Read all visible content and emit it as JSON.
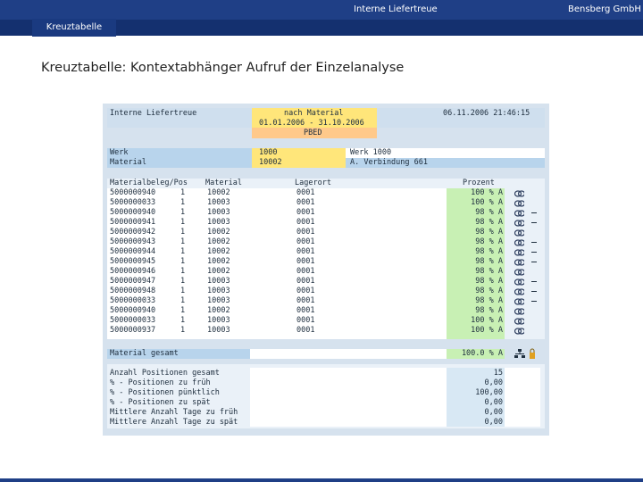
{
  "header": {
    "center_title": "Interne Liefertreue",
    "company": "Bensberg GmbH",
    "tab_label": "Kreuztabelle"
  },
  "page_title": "Kreuztabelle: Kontextabhänger Aufruf der Einzelanalyse",
  "sap": {
    "title": "Interne Liefertreue",
    "filter_label": "nach Material",
    "date_range": "01.01.2006 - 31.10.2006",
    "timestamp": "06.11.2006 21:46:15",
    "code": "PBED",
    "werk_label": "Werk",
    "werk_value": "1000",
    "werk_name": "Werk 1000",
    "material_label": "Material",
    "material_value": "10002",
    "material_name": "A. Verbindung 661",
    "columns": [
      "Materialbeleg/Pos",
      "Material",
      "Lagerort",
      "Prozent"
    ],
    "rows": [
      {
        "beleg": "5000000940",
        "pos": "1",
        "material": "10002",
        "lager": "0001",
        "prozent": "100 % A",
        "chain": true,
        "minus": false
      },
      {
        "beleg": "5000000033",
        "pos": "1",
        "material": "10003",
        "lager": "0001",
        "prozent": "100 % A",
        "chain": true,
        "minus": false
      },
      {
        "beleg": "5000000940",
        "pos": "1",
        "material": "10003",
        "lager": "0001",
        "prozent": "98 % A",
        "chain": true,
        "minus": true
      },
      {
        "beleg": "5000000941",
        "pos": "1",
        "material": "10003",
        "lager": "0001",
        "prozent": "98 % A",
        "chain": true,
        "minus": true
      },
      {
        "beleg": "5000000942",
        "pos": "1",
        "material": "10002",
        "lager": "0001",
        "prozent": "98 % A",
        "chain": true,
        "minus": false
      },
      {
        "beleg": "5000000943",
        "pos": "1",
        "material": "10002",
        "lager": "0001",
        "prozent": "98 % A",
        "chain": true,
        "minus": true
      },
      {
        "beleg": "5000000944",
        "pos": "1",
        "material": "10002",
        "lager": "0001",
        "prozent": "98 % A",
        "chain": true,
        "minus": true
      },
      {
        "beleg": "5000000945",
        "pos": "1",
        "material": "10002",
        "lager": "0001",
        "prozent": "98 % A",
        "chain": true,
        "minus": true
      },
      {
        "beleg": "5000000946",
        "pos": "1",
        "material": "10002",
        "lager": "0001",
        "prozent": "98 % A",
        "chain": true,
        "minus": false
      },
      {
        "beleg": "5000000947",
        "pos": "1",
        "material": "10003",
        "lager": "0001",
        "prozent": "98 % A",
        "chain": true,
        "minus": true
      },
      {
        "beleg": "5000000948",
        "pos": "1",
        "material": "10003",
        "lager": "0001",
        "prozent": "98 % A",
        "chain": true,
        "minus": true
      },
      {
        "beleg": "5000000033",
        "pos": "1",
        "material": "10003",
        "lager": "0001",
        "prozent": "98 % A",
        "chain": true,
        "minus": true
      },
      {
        "beleg": "5000000940",
        "pos": "1",
        "material": "10002",
        "lager": "0001",
        "prozent": "98 % A",
        "chain": true,
        "minus": false
      },
      {
        "beleg": "5000000033",
        "pos": "1",
        "material": "10003",
        "lager": "0001",
        "prozent": "100 % A",
        "chain": true,
        "minus": false
      },
      {
        "beleg": "5000000937",
        "pos": "1",
        "material": "10003",
        "lager": "0001",
        "prozent": "100 % A",
        "chain": true,
        "minus": false
      }
    ],
    "total_label": "Material gesamt",
    "total_value": "100.0 % A",
    "summary": [
      {
        "label": "Anzahl Positionen gesamt",
        "value": "15"
      },
      {
        "label": "% - Positionen zu früh",
        "value": "0,00"
      },
      {
        "label": "% - Positionen pünktlich",
        "value": "100,00"
      },
      {
        "label": "% - Positionen zu spät",
        "value": "0,00"
      },
      {
        "label": "Mittlere Anzahl Tage zu früh",
        "value": "0,00"
      },
      {
        "label": "Mittlere Anzahl Tage zu spät",
        "value": "0,00"
      }
    ]
  },
  "colors": {
    "brand": "#1f3f86",
    "panel": "#d6e2ee",
    "highlight_yellow": "#ffe67a",
    "highlight_orange": "#ffc98a",
    "highlight_green": "#c8f0b4"
  },
  "icons": [
    "chain-link-icon",
    "hierarchy-icon",
    "lock-icon"
  ]
}
